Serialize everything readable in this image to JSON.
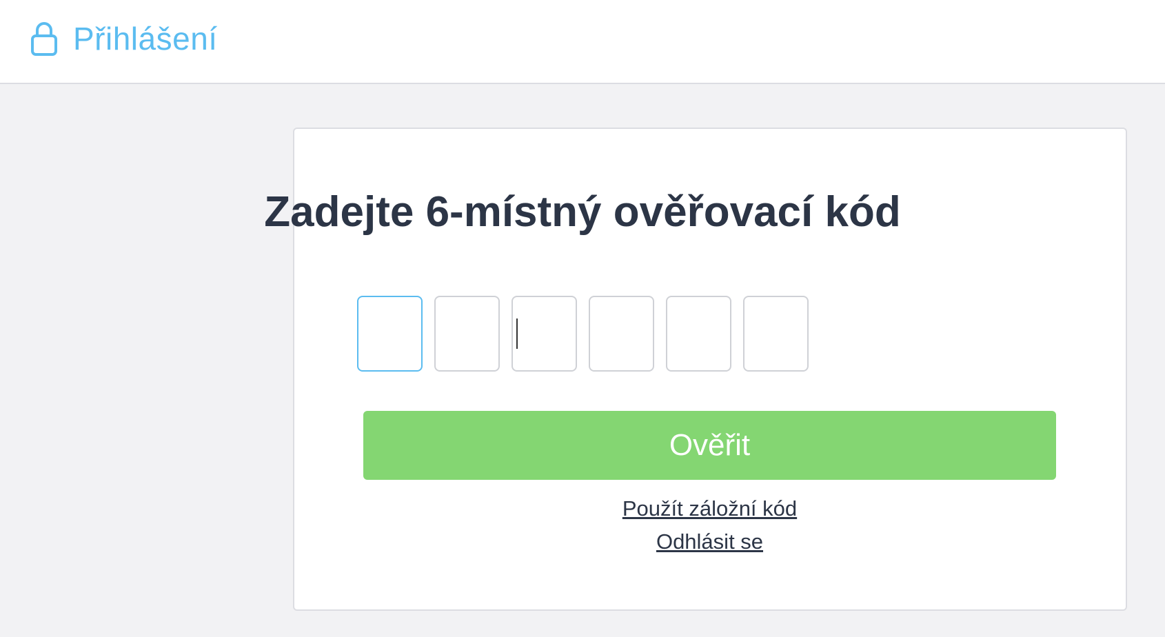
{
  "header": {
    "title": "Přihlášení",
    "icon": "lock-icon",
    "accent_color": "#5bbcf0"
  },
  "card": {
    "title": "Zadejte 6-místný ověřovací kód",
    "code_inputs": [
      {
        "value": "",
        "active": true
      },
      {
        "value": "",
        "active": false
      },
      {
        "value": "",
        "active": false
      },
      {
        "value": "",
        "active": false
      },
      {
        "value": "",
        "active": false
      },
      {
        "value": "",
        "active": false
      }
    ],
    "verify_label": "Ověřit",
    "verify_color": "#84d672",
    "backup_code_link": "Použít záložní kód",
    "logout_link": "Odhlásit se"
  }
}
